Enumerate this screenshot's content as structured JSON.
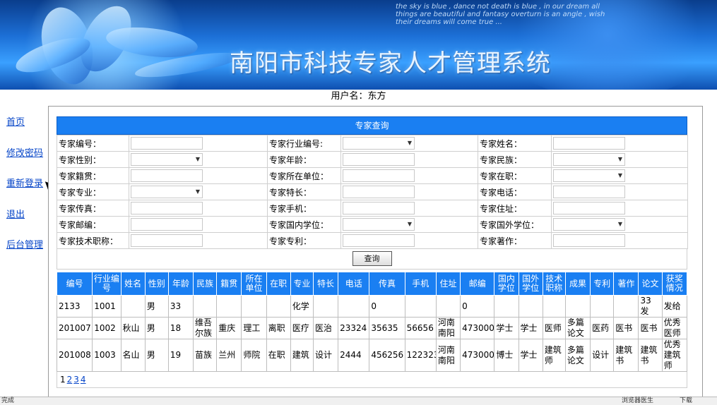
{
  "banner": {
    "title": "南阳市科技专家人才管理系统",
    "tagline": "the sky is blue , dance not death is blue , in our dream all things are beautiful and fantasy overturn is an angle , wish their dreams will come true ..."
  },
  "user": {
    "label": "用户名：东方"
  },
  "nav": [
    {
      "label": "首页"
    },
    {
      "label": "修改密码"
    },
    {
      "label": "重新登录"
    },
    {
      "label": "退出"
    },
    {
      "label": "后台管理"
    }
  ],
  "query": {
    "title": "专家查询",
    "rows": [
      [
        {
          "label": "专家编号：",
          "kind": "input"
        },
        {
          "label": "专家行业编号:",
          "kind": "select"
        },
        {
          "label": "专家姓名：",
          "kind": "input"
        }
      ],
      [
        {
          "label": "专家性别：",
          "kind": "select"
        },
        {
          "label": "专家年龄：",
          "kind": "input"
        },
        {
          "label": "专家民族：",
          "kind": "select"
        }
      ],
      [
        {
          "label": "专家籍贯：",
          "kind": "input"
        },
        {
          "label": "专家所在单位：",
          "kind": "input"
        },
        {
          "label": "专家在职：",
          "kind": "select"
        }
      ],
      [
        {
          "label": "专家专业：",
          "kind": "select"
        },
        {
          "label": "专家特长：",
          "kind": "input"
        },
        {
          "label": "专家电话：",
          "kind": "input"
        }
      ],
      [
        {
          "label": "专家传真：",
          "kind": "input"
        },
        {
          "label": "专家手机：",
          "kind": "input"
        },
        {
          "label": "专家住址：",
          "kind": "input"
        }
      ],
      [
        {
          "label": "专家邮编：",
          "kind": "input"
        },
        {
          "label": "专家国内学位：",
          "kind": "select"
        },
        {
          "label": "专家国外学位：",
          "kind": "select"
        }
      ],
      [
        {
          "label": "专家技术职称：",
          "kind": "input"
        },
        {
          "label": "专家专利：",
          "kind": "input"
        },
        {
          "label": "专家著作：",
          "kind": "input"
        }
      ]
    ],
    "button": "查询"
  },
  "results": {
    "columns": [
      "编号",
      "行业编号",
      "姓名",
      "性别",
      "年龄",
      "民族",
      "籍贯",
      "所在单位",
      "在职",
      "专业",
      "特长",
      "电话",
      "传真",
      "手机",
      "住址",
      "邮编",
      "国内学位",
      "国外学位",
      "技术职称",
      "成果",
      "专利",
      "著作",
      "论文",
      "获奖情况"
    ],
    "rows": [
      [
        "2133",
        "1001",
        "",
        "男",
        "33",
        "",
        "",
        "",
        "",
        "化学",
        "",
        "",
        "0",
        "",
        "",
        "0",
        "",
        "",
        "",
        "",
        "",
        "",
        "33 发",
        "发给"
      ],
      [
        "201007",
        "1002",
        "秋山",
        "男",
        "18",
        "维吾尔族",
        "重庆",
        "理工",
        "离职",
        "医疗",
        "医治",
        "23324",
        "35635",
        "56656",
        "河南南阳",
        "473000",
        "学士",
        "学士",
        "医师",
        "多篇论文",
        "医药",
        "医书",
        "医书",
        "优秀医师"
      ],
      [
        "201008",
        "1003",
        "名山",
        "男",
        "19",
        "苗族",
        "兰州",
        "师院",
        "在职",
        "建筑",
        "设计",
        "2444",
        "456256",
        "122323",
        "河南南阳",
        "473000",
        "博士",
        "学士",
        "建筑师",
        "多篇论文",
        "设计",
        "建筑书",
        "建筑书",
        "优秀建筑师"
      ]
    ],
    "pages": [
      "1",
      "2",
      "3",
      "4"
    ]
  },
  "status": {
    "left": "完成",
    "right1": "浏览器医生",
    "right2": "下载"
  }
}
